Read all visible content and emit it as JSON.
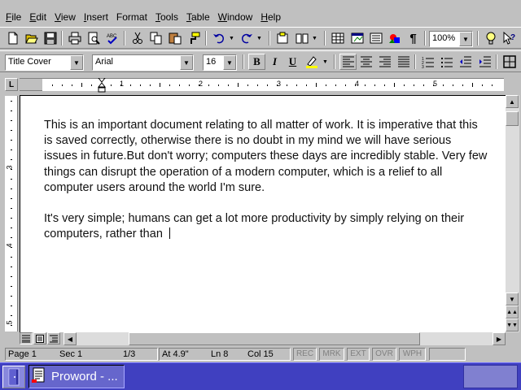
{
  "menu": [
    {
      "label": "File",
      "accel": "F",
      "rest": "ile"
    },
    {
      "label": "Edit",
      "accel": "E",
      "rest": "dit"
    },
    {
      "label": "View",
      "accel": "V",
      "rest": "iew"
    },
    {
      "label": "Insert",
      "accel": "I",
      "rest": "nsert"
    },
    {
      "label": "Format",
      "accel": "F",
      "rest": "ormat",
      "prefix": ""
    },
    {
      "label": "Tools",
      "accel": "T",
      "rest": "ools"
    },
    {
      "label": "Table",
      "accel": "T",
      "rest": "able"
    },
    {
      "label": "Window",
      "accel": "W",
      "rest": "indow"
    },
    {
      "label": "Help",
      "accel": "H",
      "rest": "elp"
    }
  ],
  "toolbar": {
    "zoom": "100%",
    "icons": [
      "new-icon",
      "open-icon",
      "save-icon",
      "print-icon",
      "print-preview-icon",
      "spellcheck-icon",
      "cut-icon",
      "copy-icon",
      "paste-icon",
      "format-painter-icon",
      "undo-icon",
      "redo-icon",
      "insert-address-icon",
      "insert-book-icon",
      "insert-table-icon",
      "insert-spreadsheet-icon",
      "columns-icon",
      "drawing-icon",
      "show-paragraph-icon",
      "tip-icon",
      "help-pointer-icon"
    ]
  },
  "format_bar": {
    "style": "Title Cover",
    "font": "Arial",
    "size": "16",
    "bold": "B",
    "italic": "I",
    "underline": "U"
  },
  "ruler": {
    "numbers": [
      "1",
      "2",
      "3",
      "4",
      "5"
    ],
    "corner": "L"
  },
  "vruler": {
    "numbers": [
      "3",
      "4",
      "5"
    ]
  },
  "document": {
    "paragraph1": "This is an important document relating to all matter of work. It is imperative that this is saved correctly, otherwise there is no doubt in my mind we will have serious issues in future.But don't worry; computers these days are incredibly stable. Very few things can disrupt the operation of a modern computer, which is a relief to all computer users around the world I'm sure.",
    "paragraph2": "It's very simple; humans can get a lot more productivity by simply relying on their computers, rather than"
  },
  "status": {
    "page": "Page 1",
    "sec": "Sec 1",
    "pages": "1/3",
    "at": "At 4.9\"",
    "ln": "Ln 8",
    "col": "Col 15",
    "rec": "REC",
    "mrk": "MRK",
    "ext": "EXT",
    "ovr": "OVR",
    "wph": "WPH"
  },
  "taskbar": {
    "task_label": "Proword - ..."
  },
  "colors": {
    "taskbar": "#4040c0",
    "face": "#c0c0c0"
  }
}
